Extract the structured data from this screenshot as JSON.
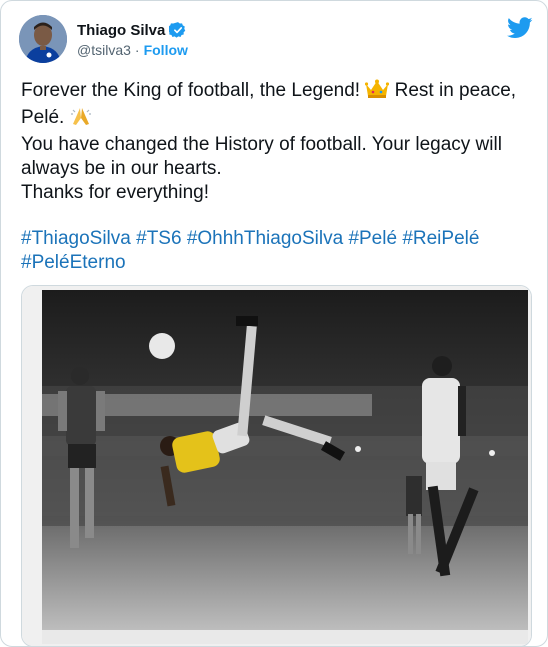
{
  "user": {
    "name": "Thiago Silva",
    "handle": "@tsilva3",
    "separator": "·",
    "follow_label": "Follow"
  },
  "icons": {
    "verified": "verified-badge-icon",
    "brand": "twitter-bird-icon",
    "crown": "crown-emoji",
    "pray": "folded-hands-emoji"
  },
  "colors": {
    "link": "#1b73b9",
    "accent": "#1d9bf0",
    "text": "#0f1419",
    "muted": "#536471"
  },
  "tweet": {
    "line1_a": "Forever the King of football, the Legend! ",
    "line1_b": " Rest in peace, Pelé. ",
    "line2": "You have changed the History of football. Your legacy will always be in our hearts.",
    "line3": "Thanks for everything!"
  },
  "hashtags": [
    "#ThiagoSilva",
    "#TS6",
    "#OhhhThiagoSilva",
    "#Pelé",
    "#ReiPelé",
    "#PeléEterno"
  ]
}
